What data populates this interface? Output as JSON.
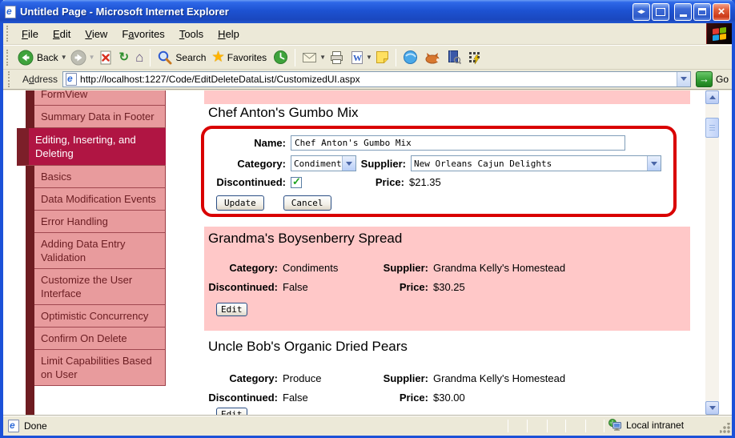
{
  "window": {
    "title": "Untitled Page - Microsoft Internet Explorer"
  },
  "window_controls": {
    "restore_arrows_glyph": "◂▸",
    "close_glyph": "×"
  },
  "menu_bar": {
    "items": [
      {
        "label": "File",
        "accel": 0
      },
      {
        "label": "Edit",
        "accel": 0
      },
      {
        "label": "View",
        "accel": 0
      },
      {
        "label": "Favorites",
        "accel": 1
      },
      {
        "label": "Tools",
        "accel": 0
      },
      {
        "label": "Help",
        "accel": 0
      }
    ]
  },
  "toolbar": {
    "back_label": "Back",
    "search_label": "Search",
    "favorites_label": "Favorites",
    "refresh_glyph": "↻",
    "home_glyph": "⌂",
    "favorites_star_glyph": "★",
    "edit_doc_glyph": "W"
  },
  "address_bar": {
    "label": "Address",
    "url": "http://localhost:1227/Code/EditDeleteDataList/CustomizedUI.aspx",
    "go_label": "Go",
    "go_arrow_glyph": "→"
  },
  "sidebar": {
    "items": [
      {
        "label": "FormView",
        "selected": false
      },
      {
        "label": "Summary Data in Footer",
        "selected": false
      },
      {
        "label": "Editing, Inserting, and Deleting",
        "selected": true
      },
      {
        "label": "Basics",
        "selected": false
      },
      {
        "label": "Data Modification Events",
        "selected": false
      },
      {
        "label": "Error Handling",
        "selected": false
      },
      {
        "label": "Adding Data Entry Validation",
        "selected": false
      },
      {
        "label": "Customize the User Interface",
        "selected": false
      },
      {
        "label": "Optimistic Concurrency",
        "selected": false
      },
      {
        "label": "Confirm On Delete",
        "selected": false
      },
      {
        "label": "Limit Capabilities Based on User",
        "selected": false
      }
    ]
  },
  "content": {
    "editing_item": {
      "title": "Chef Anton's Gumbo Mix",
      "name_label": "Name:",
      "name_value": "Chef Anton's Gumbo Mix",
      "category_label": "Category:",
      "category_value": "Condiments",
      "supplier_label": "Supplier:",
      "supplier_value": "New Orleans Cajun Delights",
      "discontinued_label": "Discontinued:",
      "discontinued_checked": true,
      "price_label": "Price:",
      "price_value": "$21.35",
      "update_button": "Update",
      "cancel_button": "Cancel"
    },
    "items": [
      {
        "title": "Grandma's Boysenberry Spread",
        "category_label": "Category:",
        "category": "Condiments",
        "supplier_label": "Supplier:",
        "supplier": "Grandma Kelly's Homestead",
        "discontinued_label": "Discontinued:",
        "discontinued": "False",
        "price_label": "Price:",
        "price": "$30.25",
        "edit_button": "Edit"
      },
      {
        "title": "Uncle Bob's Organic Dried Pears",
        "category_label": "Category:",
        "category": "Produce",
        "supplier_label": "Supplier:",
        "supplier": "Grandma Kelly's Homestead",
        "discontinued_label": "Discontinued:",
        "discontinued": "False",
        "price_label": "Price:",
        "price": "$30.00",
        "edit_button": "Edit"
      }
    ]
  },
  "status_bar": {
    "status_text": "Done",
    "zone_text": "Local intranet"
  },
  "colors": {
    "annotation_red": "#D90000",
    "sidebar_pink": "#E89B9D",
    "sidebar_maroon": "#6E1C21",
    "selected_crimson": "#B01543",
    "content_pink": "#FFC8C8",
    "chrome_beige": "#ECE9D8",
    "title_blue": "#1D52D2"
  }
}
